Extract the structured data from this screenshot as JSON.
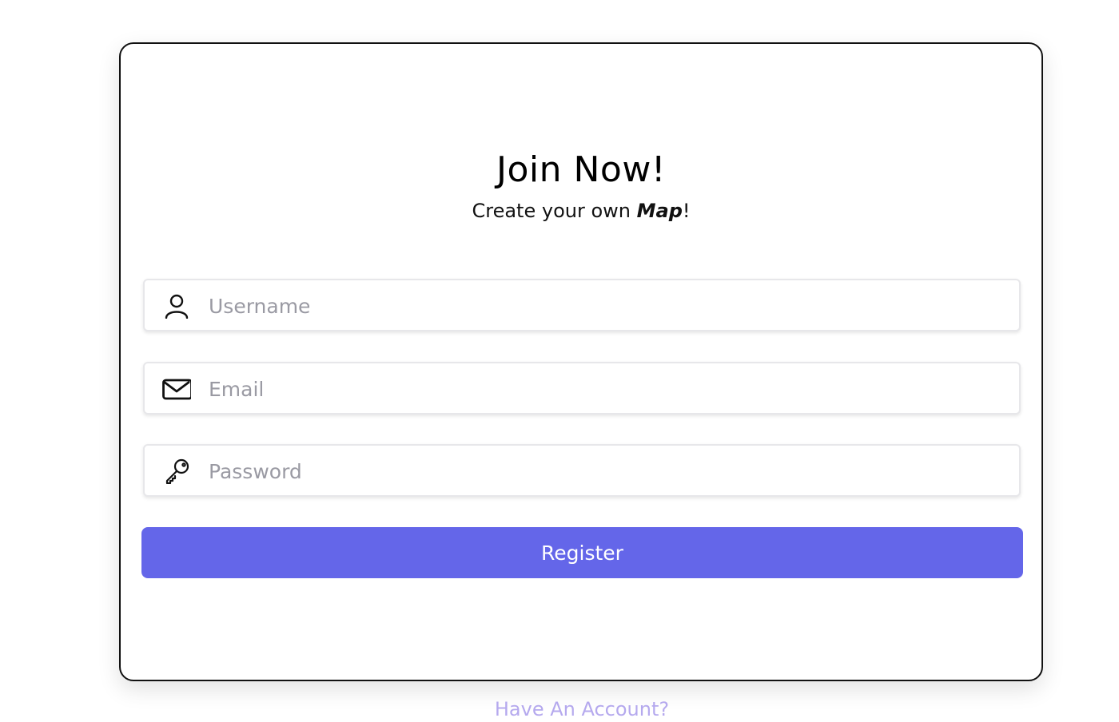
{
  "form": {
    "title": "Join Now!",
    "subtitle_prefix": "Create your own ",
    "subtitle_emphasis": "Map",
    "subtitle_suffix": "!",
    "fields": {
      "username": {
        "placeholder": "Username",
        "value": "",
        "icon": "user-icon"
      },
      "email": {
        "placeholder": "Email",
        "value": "",
        "icon": "mail-icon"
      },
      "password": {
        "placeholder": "Password",
        "value": "",
        "icon": "key-icon"
      }
    },
    "register_label": "Register"
  },
  "footer": {
    "have_account_label": "Have An Account?"
  },
  "colors": {
    "primary": "#6466e9",
    "link": "#b5a9ee",
    "placeholder": "#9a9aa3",
    "border": "#111111"
  }
}
